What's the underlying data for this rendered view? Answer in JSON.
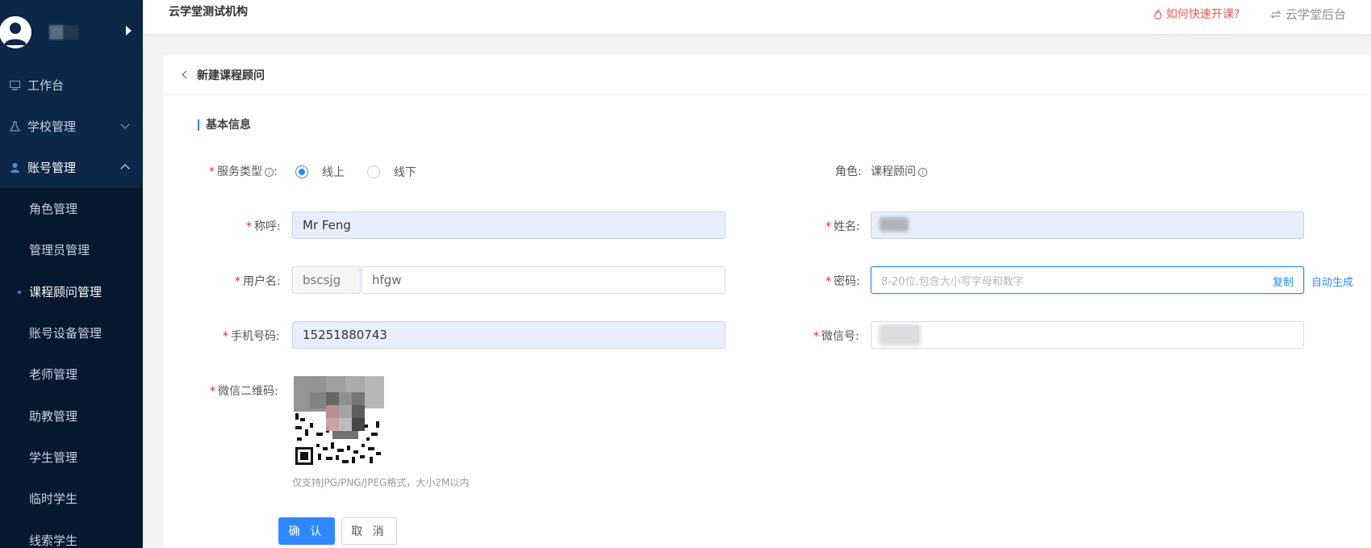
{
  "sidebar": {
    "menu": [
      {
        "label": "工作台",
        "icon": "dashboard-icon"
      },
      {
        "label": "学校管理",
        "icon": "flask-icon",
        "expanded": false
      },
      {
        "label": "账号管理",
        "icon": "user-icon",
        "expanded": true
      }
    ],
    "submenu": [
      {
        "label": "角色管理"
      },
      {
        "label": "管理员管理"
      },
      {
        "label": "课程顾问管理",
        "active": true
      },
      {
        "label": "账号设备管理"
      },
      {
        "label": "老师管理"
      },
      {
        "label": "助教管理"
      },
      {
        "label": "学生管理"
      },
      {
        "label": "临时学生"
      },
      {
        "label": "线索学生"
      }
    ]
  },
  "header": {
    "org_name": "云学堂测试机构",
    "help_link": "如何快速开课?",
    "backend_link": "云学堂后台"
  },
  "page": {
    "title": "新建课程顾问",
    "section_title": "基本信息"
  },
  "form": {
    "service_type": {
      "label": "服务类型",
      "colon": ":",
      "options": [
        "线上",
        "线下"
      ],
      "selected": "线上"
    },
    "role": {
      "label": "角色:",
      "value": "课程顾问"
    },
    "nickname": {
      "label": "称呼:",
      "value": "Mr Feng"
    },
    "name": {
      "label": "姓名:"
    },
    "username": {
      "label": "用户名:",
      "prefix": "bscsjg",
      "value": "hfgw"
    },
    "password": {
      "label": "密码:",
      "placeholder": "8-20位,包含大小写字母和数字",
      "copy": "复制",
      "auto_generate": "自动生成"
    },
    "phone": {
      "label": "手机号码:",
      "value": "15251880743"
    },
    "wechat": {
      "label": "微信号:"
    },
    "wechat_qr": {
      "label": "微信二维码:",
      "hint": "仅支持JPG/PNG/JPEG格式，大小2M以内"
    }
  },
  "actions": {
    "confirm": "确 认",
    "cancel": "取 消"
  },
  "colors": {
    "sidebar_bg": "#0c2748",
    "sidebar_sub_bg": "#06172e",
    "primary": "#2f88ff",
    "required": "#f5222d",
    "help_link": "#f05b4f"
  }
}
